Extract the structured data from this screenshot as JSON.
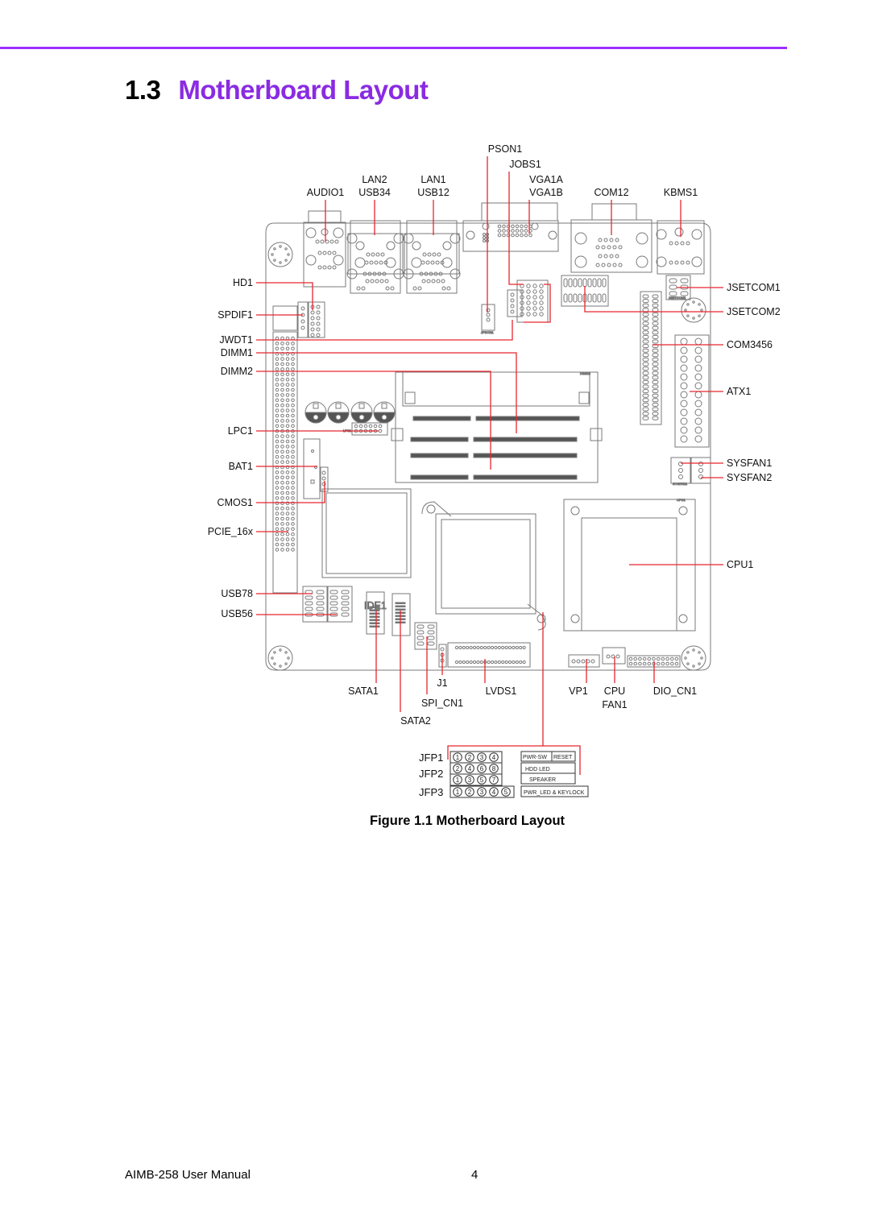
{
  "page": {
    "section_number": "1.3",
    "section_title": "Motherboard Layout",
    "figure_caption": "Figure 1.1 Motherboard Layout",
    "footer_manual": "AIMB-258 User Manual",
    "footer_page": "4"
  },
  "colors": {
    "accent": "#8a2be2",
    "rule": "#9b30ff",
    "leader": "#e8262e",
    "outline": "#7a7a7a"
  },
  "diagram": {
    "top_labels": [
      {
        "id": "audio1",
        "lines": [
          "AUDIO1"
        ]
      },
      {
        "id": "lan2-usb34",
        "lines": [
          "LAN2",
          "USB34"
        ]
      },
      {
        "id": "lan1-usb12",
        "lines": [
          "LAN1",
          "USB12"
        ]
      },
      {
        "id": "pson1",
        "lines": [
          "PSON1"
        ]
      },
      {
        "id": "jobs1",
        "lines": [
          "JOBS1"
        ]
      },
      {
        "id": "vga1",
        "lines": [
          "VGA1A",
          "VGA1B"
        ]
      },
      {
        "id": "com12",
        "lines": [
          "COM12"
        ]
      },
      {
        "id": "kbms1",
        "lines": [
          "KBMS1"
        ]
      }
    ],
    "left_labels": [
      "HD1",
      "SPDIF1",
      "JWDT1",
      "DIMM1",
      "DIMM2",
      "LPC1",
      "BAT1",
      "CMOS1",
      "PCIE_16x",
      "USB78",
      "USB56"
    ],
    "right_labels": [
      "JSETCOM1",
      "JSETCOM2",
      "COM3456",
      "ATX1",
      "SYSFAN1",
      "SYSFAN2",
      "CPU1"
    ],
    "bottom_labels": [
      {
        "id": "sata1",
        "lines": [
          "SATA1"
        ]
      },
      {
        "id": "sata2",
        "lines": [
          "SATA2"
        ]
      },
      {
        "id": "spi-cn1",
        "lines": [
          "SPI_CN1"
        ]
      },
      {
        "id": "j1",
        "lines": [
          "J1"
        ]
      },
      {
        "id": "lvds1",
        "lines": [
          "LVDS1"
        ]
      },
      {
        "id": "vp1",
        "lines": [
          "VP1"
        ]
      },
      {
        "id": "cpufan1",
        "lines": [
          "CPU",
          "FAN1"
        ]
      },
      {
        "id": "dio-cn1",
        "lines": [
          "DIO_CN1"
        ]
      }
    ],
    "board_text": {
      "ide1": "IDE1",
      "dimm2_silk": "DIMM2",
      "cpu1_silk": "CPU1",
      "jsetcom1_silk": "JSETCOM1",
      "pson1_silk": "JPSON1",
      "sysfan2_silk": "SYSFAN2",
      "lpc1_silk": "LPC1"
    },
    "front_panel": {
      "jfp1": {
        "label": "JFP1",
        "pins": [
          "1",
          "2",
          "3",
          "4"
        ]
      },
      "jfp2": {
        "label": "JFP2",
        "pins_top": [
          "2",
          "4",
          "6",
          "8"
        ],
        "pins_bottom": [
          "1",
          "3",
          "5",
          "7"
        ]
      },
      "jfp3": {
        "label": "JFP3",
        "pins": [
          "1",
          "2",
          "3",
          "4",
          "5"
        ]
      },
      "functions": {
        "pwr_sw": "PWR-SW",
        "reset": "RESET",
        "hdd_led": "HDD LED",
        "speaker": "SPEAKER",
        "pwr_led_keylock": "PWR_LED & KEYLOCK"
      }
    }
  }
}
